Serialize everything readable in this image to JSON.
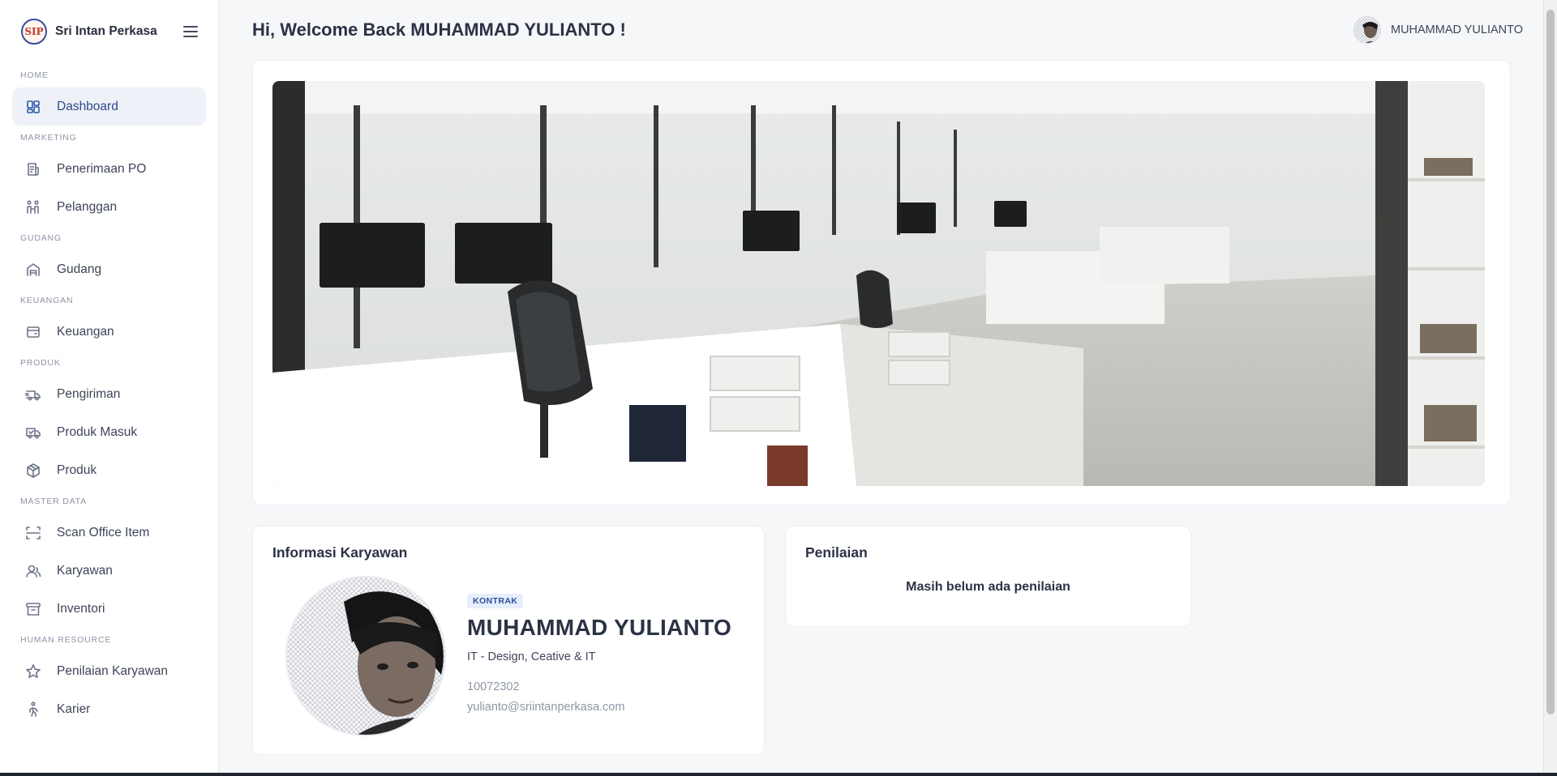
{
  "brand": {
    "name": "Sri Intan Perkasa",
    "logo_text": "SIP"
  },
  "sidebar": {
    "sections": [
      {
        "label": "HOME",
        "items": [
          {
            "label": "Dashboard",
            "icon": "dashboard-icon",
            "active": true
          }
        ]
      },
      {
        "label": "MARKETING",
        "items": [
          {
            "label": "Penerimaan PO",
            "icon": "receipt-icon"
          },
          {
            "label": "Pelanggan",
            "icon": "customers-icon"
          }
        ]
      },
      {
        "label": "GUDANG",
        "items": [
          {
            "label": "Gudang",
            "icon": "warehouse-icon"
          }
        ]
      },
      {
        "label": "KEUANGAN",
        "items": [
          {
            "label": "Keuangan",
            "icon": "wallet-icon"
          }
        ]
      },
      {
        "label": "PRODUK",
        "items": [
          {
            "label": "Pengiriman",
            "icon": "truck-fast-icon"
          },
          {
            "label": "Produk Masuk",
            "icon": "truck-icon"
          },
          {
            "label": "Produk",
            "icon": "box-icon"
          }
        ]
      },
      {
        "label": "MASTER DATA",
        "items": [
          {
            "label": "Scan Office Item",
            "icon": "scan-icon"
          },
          {
            "label": "Karyawan",
            "icon": "user-icon"
          },
          {
            "label": "Inventori",
            "icon": "archive-icon"
          }
        ]
      },
      {
        "label": "HUMAN RESOURCE",
        "items": [
          {
            "label": "Penilaian Karyawan",
            "icon": "star-icon"
          },
          {
            "label": "Karier",
            "icon": "walk-icon"
          }
        ]
      }
    ]
  },
  "header": {
    "welcome": "Hi, Welcome Back MUHAMMAD YULIANTO !",
    "user_name": "MUHAMMAD YULIANTO"
  },
  "employee_card": {
    "title": "Informasi Karyawan",
    "status": "KONTRAK",
    "name": "MUHAMMAD YULIANTO",
    "department": "IT - Design, Ceative & IT",
    "employee_id": "10072302",
    "email": "yulianto@sriintanperkasa.com"
  },
  "rating_card": {
    "title": "Penilaian",
    "empty_text": "Masih belum ada penilaian"
  },
  "colors": {
    "accent": "#2c5aa8",
    "active_bg": "#eef1f7",
    "page_bg": "#f6f7f9"
  }
}
